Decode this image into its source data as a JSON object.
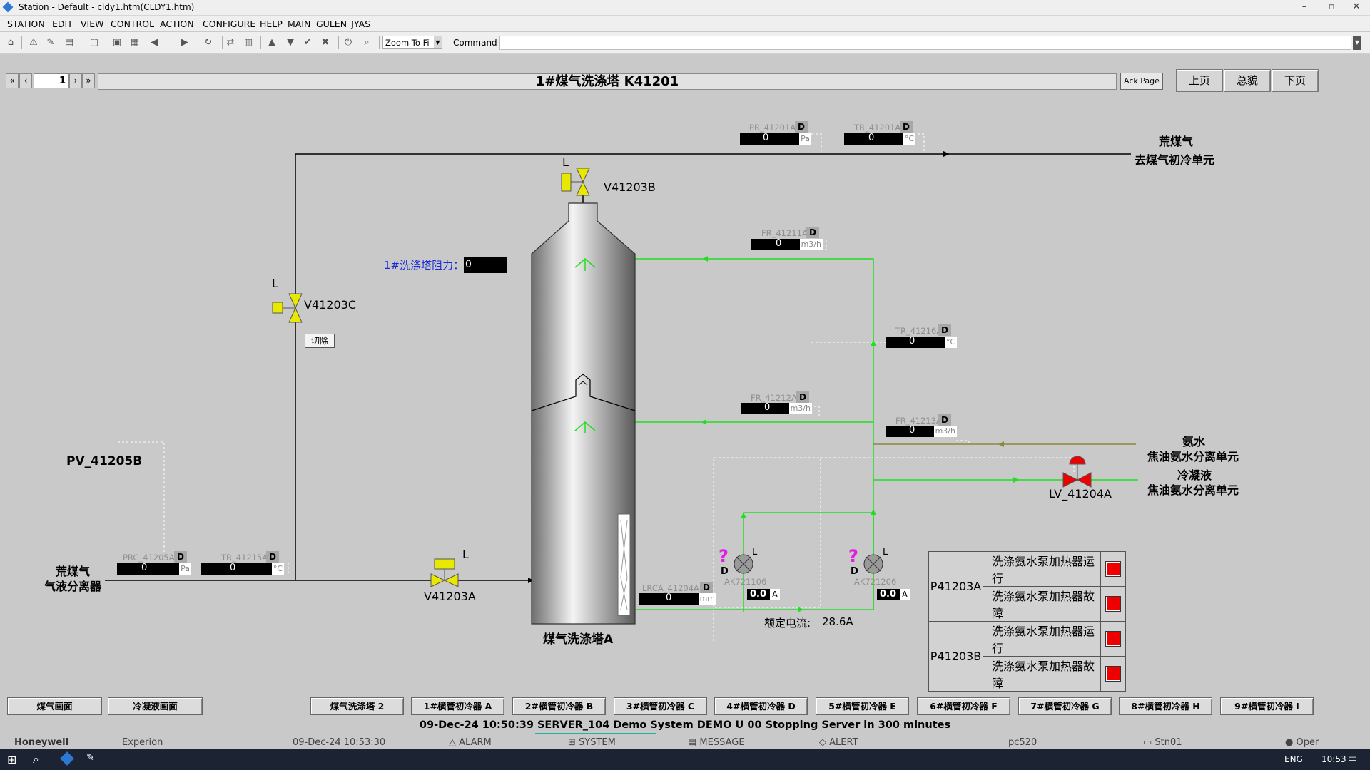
{
  "window": {
    "title": "Station - Default - cldy1.htm(CLDY1.htm)",
    "min": "–",
    "max": "▫",
    "close": "✕"
  },
  "menu": [
    "STATION",
    "EDIT",
    "VIEW",
    "CONTROL",
    "ACTION",
    "CONFIGURE",
    "HELP",
    "MAIN",
    "GULEN_JYAS"
  ],
  "toolbar": {
    "zoom": "Zoom To Fi",
    "command_label": "Command",
    "command_value": ""
  },
  "pagenav": {
    "page": "1",
    "first": "«",
    "prev": "‹",
    "next": "›",
    "last": "»"
  },
  "header": {
    "title": "1#煤气洗涤塔  K41201",
    "ack": "Ack Page",
    "btn_prev": "上页",
    "btn_overview": "总貌",
    "btn_next": "下页"
  },
  "process": {
    "pv_label": "PV_41205B",
    "inlet_label_1": "荒煤气",
    "inlet_label_2": "气液分离器",
    "outlet_label_1": "荒煤气",
    "outlet_label_2": "去煤气初冷单元",
    "ammonia_1": "氨水",
    "ammonia_2": "焦油氨水分离单元",
    "condensate_1": "冷凝液",
    "condensate_2": "焦油氨水分离单元",
    "tower_name": "煤气洗涤塔A",
    "resistance_label": "1#洗涤塔阻力：",
    "resistance_value": "0",
    "cut_button": "切除",
    "rated_current_label": "额定电流:",
    "rated_current_value": "28.6A",
    "valves": {
      "v41203b": "V41203B",
      "v41203c": "V41203C",
      "v41203a": "V41203A",
      "lv41204a": "LV_41204A",
      "L": "L"
    },
    "pumps": {
      "p1_tag": "AK721106",
      "p2_tag": "AK721206",
      "p1_current": "0.0",
      "p2_current": "0.0",
      "unit": "A",
      "q": "?",
      "D": "D",
      "L": "L"
    },
    "instruments": [
      {
        "tag": "PR_41201A",
        "value": "0",
        "unit": "Pa",
        "d": "D"
      },
      {
        "tag": "TR_41201A",
        "value": "0",
        "unit": "°C",
        "d": "D"
      },
      {
        "tag": "FR_41211A",
        "value": "0",
        "unit": "m3/h",
        "d": "D"
      },
      {
        "tag": "TR_41216A",
        "value": "0",
        "unit": "°C",
        "d": "D"
      },
      {
        "tag": "FR_41212A",
        "value": "0",
        "unit": "m3/h",
        "d": "D"
      },
      {
        "tag": "FR_41213A",
        "value": "0",
        "unit": "m3/h",
        "d": "D"
      },
      {
        "tag": "PRC_41205A",
        "value": "0",
        "unit": "Pa",
        "d": "D"
      },
      {
        "tag": "TR_41215A",
        "value": "0",
        "unit": "°C",
        "d": "D"
      },
      {
        "tag": "LRCA_41204A",
        "value": "0",
        "unit": "mm",
        "d": "D"
      }
    ]
  },
  "status_table": {
    "rows": [
      {
        "pump": "P41203A",
        "items": [
          "洗涤氨水泵加热器运行",
          "洗涤氨水泵加热器故障"
        ]
      },
      {
        "pump": "P41203B",
        "items": [
          "洗涤氨水泵加热器运行",
          "洗涤氨水泵加热器故障"
        ]
      }
    ],
    "indicator_color": "#ee0000"
  },
  "bottom_nav": [
    "煤气画面",
    "冷凝液画面",
    "煤气洗涤塔 2",
    "1#横管初冷器 A",
    "2#横管初冷器 B",
    "3#横管初冷器 C",
    "4#横管初冷器 D",
    "5#横管初冷器 E",
    "6#横管初冷器 F",
    "7#横管初冷器 G",
    "8#横管初冷器 H",
    "9#横管初冷器 I"
  ],
  "status_line": "09-Dec-24  10:50:39  SERVER_104  Demo System  DEMO  U 00 Stopping Server in 300 minutes",
  "statusbar": {
    "brand": "Honeywell",
    "product": "Experion",
    "datetime": "09-Dec-24   10:53:30",
    "alarm": "ALARM",
    "system": "SYSTEM",
    "message": "MESSAGE",
    "alert": "ALERT",
    "node": "pc520",
    "station": "Stn01",
    "user": "Oper"
  },
  "taskbar": {
    "lang": "ENG",
    "time": "10:53"
  }
}
